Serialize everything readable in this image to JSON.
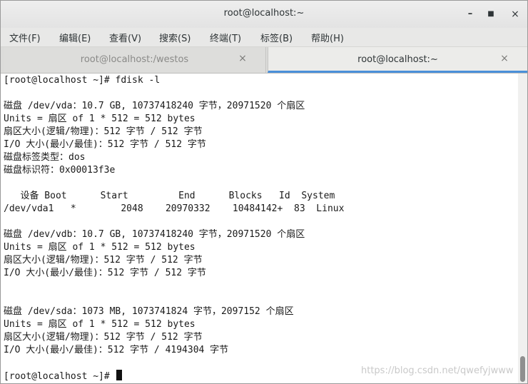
{
  "window": {
    "title": "root@localhost:~",
    "minimize": "–",
    "maximize": "■",
    "close": "×"
  },
  "menu": [
    "文件(F)",
    "编辑(E)",
    "查看(V)",
    "搜索(S)",
    "终端(T)",
    "标签(B)",
    "帮助(H)"
  ],
  "tabs": [
    {
      "label": "root@localhost:/westos",
      "close": "×",
      "active": false
    },
    {
      "label": "root@localhost:~",
      "close": "×",
      "active": true
    }
  ],
  "terminal": {
    "lines": [
      "[root@localhost ~]# fdisk -l",
      "",
      "磁盘 /dev/vda：10.7 GB, 10737418240 字节，20971520 个扇区",
      "Units = 扇区 of 1 * 512 = 512 bytes",
      "扇区大小(逻辑/物理)：512 字节 / 512 字节",
      "I/O 大小(最小/最佳)：512 字节 / 512 字节",
      "磁盘标签类型：dos",
      "磁盘标识符：0x00013f3e",
      "",
      "   设备 Boot      Start         End      Blocks   Id  System",
      "/dev/vda1   *        2048    20970332    10484142+  83  Linux",
      "",
      "磁盘 /dev/vdb：10.7 GB, 10737418240 字节，20971520 个扇区",
      "Units = 扇区 of 1 * 512 = 512 bytes",
      "扇区大小(逻辑/物理)：512 字节 / 512 字节",
      "I/O 大小(最小/最佳)：512 字节 / 512 字节",
      "",
      "",
      "磁盘 /dev/sda：1073 MB, 1073741824 字节，2097152 个扇区",
      "Units = 扇区 of 1 * 512 = 512 bytes",
      "扇区大小(逻辑/物理)：512 字节 / 512 字节",
      "I/O 大小(最小/最佳)：512 字节 / 4194304 字节",
      "",
      "[root@localhost ~]# "
    ]
  },
  "watermark": "https://blog.csdn.net/qwefyjwww",
  "colors": {
    "active_tab_accent": "#4a90d9",
    "terminal_background": "#ffffff",
    "terminal_text": "#1a1a1a"
  }
}
